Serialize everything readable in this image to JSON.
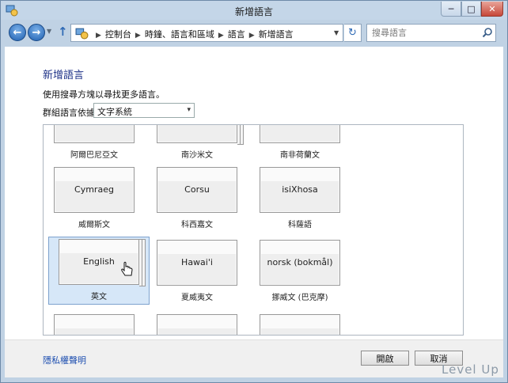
{
  "window": {
    "title": "新增語言",
    "minimize": "─",
    "maximize": "□",
    "close": "✕"
  },
  "nav": {
    "back": "←",
    "forward": "→",
    "history": "▼",
    "up": "↑",
    "refresh": "↻",
    "breadcrumbs": [
      "控制台",
      "時鐘、語言和區域",
      "語言",
      "新增語言"
    ],
    "search_placeholder": "搜尋語言",
    "address_dropdown": "▼"
  },
  "main": {
    "title": "新增語言",
    "description": "使用搜尋方塊以尋找更多語言。",
    "group_label": "群組語言依據:",
    "group_value": "文字系統",
    "group_arrow": "▾"
  },
  "languages": [
    {
      "card": "",
      "label": "阿爾巴尼亞文"
    },
    {
      "card": "",
      "label": "南沙米文"
    },
    {
      "card": "",
      "label": "南非荷蘭文"
    },
    {
      "card": "Cymraeg",
      "label": "威爾斯文"
    },
    {
      "card": "Corsu",
      "label": "科西嘉文"
    },
    {
      "card": "isiXhosa",
      "label": "科薩語"
    },
    {
      "card": "English",
      "label": "英文"
    },
    {
      "card": "Hawai'i",
      "label": "夏威夷文"
    },
    {
      "card": "norsk (bokmål)",
      "label": "挪威文 (巴克摩)"
    },
    {
      "card": "",
      "label": ""
    },
    {
      "card": "",
      "label": ""
    },
    {
      "card": "",
      "label": ""
    }
  ],
  "scrollbar": {
    "up": "▲",
    "down": "▼"
  },
  "footer": {
    "privacy": "隱私權聲明",
    "open": "開啟",
    "cancel": "取消"
  },
  "watermark": "Level Up"
}
